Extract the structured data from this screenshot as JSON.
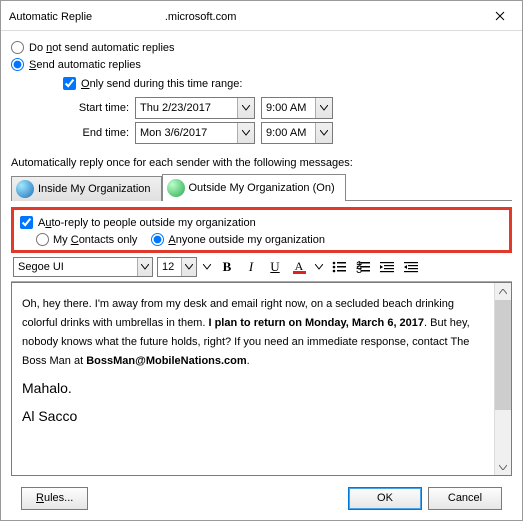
{
  "window": {
    "title_prefix": "Automatic Replie",
    "title_suffix": ".microsoft.com"
  },
  "mode": {
    "do_not_send": "Do not send automatic replies",
    "send": "Send automatic replies",
    "selected": "send"
  },
  "only_range": {
    "label": "Only send during this time range:",
    "checked": true
  },
  "time": {
    "start_label": "Start time:",
    "end_label": "End time:",
    "start_date": "Thu 2/23/2017",
    "start_time": "9:00 AM",
    "end_date": "Mon 3/6/2017",
    "end_time": "9:00 AM"
  },
  "section_label": "Automatically reply once for each sender with the following messages:",
  "tabs": {
    "inside": "Inside My Organization",
    "outside": "Outside My Organization (On)",
    "active": "outside"
  },
  "outside_opts": {
    "auto_reply": "Auto-reply to people outside my organization",
    "auto_reply_checked": true,
    "contacts_only": "My Contacts only",
    "anyone": "Anyone outside my organization",
    "selected": "anyone"
  },
  "toolbar": {
    "font": "Segoe UI",
    "size": "12"
  },
  "message": {
    "p1a": "Oh, hey there. I'm away from my desk and email right now, on a secluded beach drinking colorful drinks with umbrellas in them. ",
    "p1b": "I plan to return on Monday, March 6, 2017",
    "p1c": ". But hey, nobody knows what the future holds, right? If you need an immediate response, contact The Boss Man at ",
    "p1d": "BossMan@MobileNations.com",
    "p1e": ".",
    "p2": "Mahalo.",
    "p3": "Al Sacco"
  },
  "footer": {
    "rules": "Rules...",
    "ok": "OK",
    "cancel": "Cancel"
  }
}
